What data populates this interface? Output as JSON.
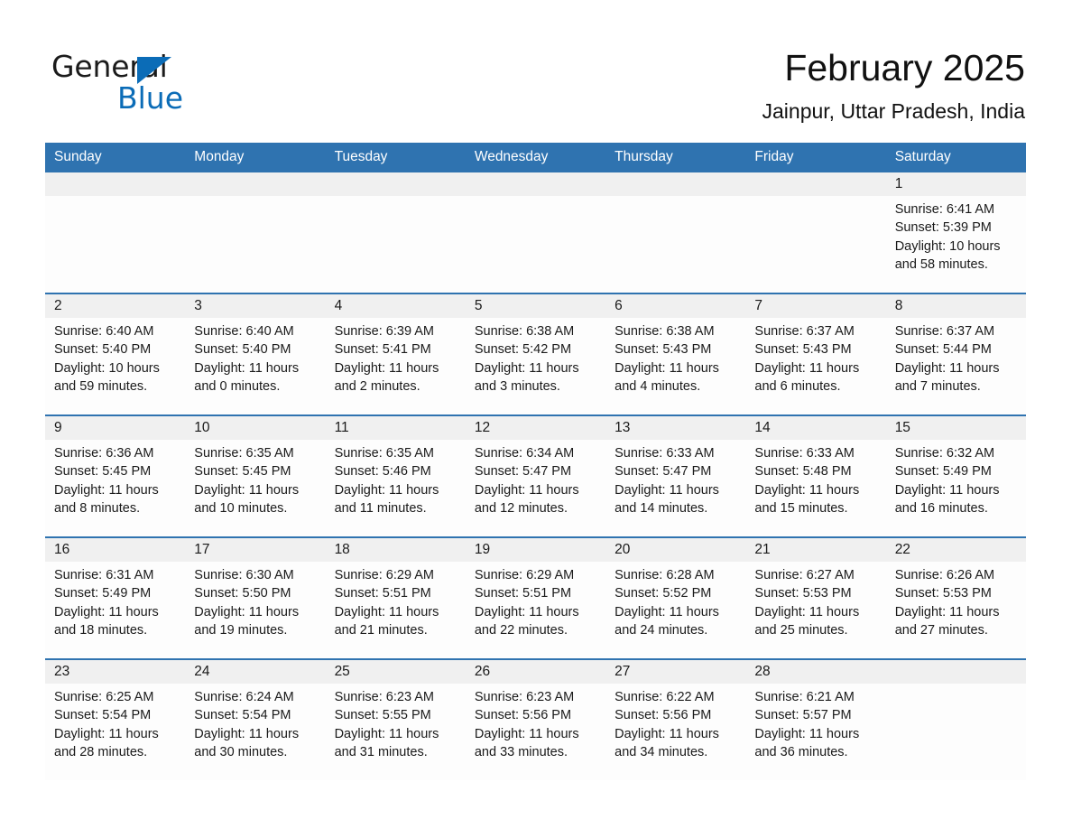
{
  "logo": {
    "word_one": "General",
    "word_two": "Blue",
    "accent_color": "#0b6cb7"
  },
  "header": {
    "title": "February 2025",
    "subtitle": "Jainpur, Uttar Pradesh, India"
  },
  "theme": {
    "header_blue": "#2f73b0",
    "band_gray": "#f0f0f0",
    "cell_white": "#fdfdfd",
    "text": "#1a1a1a"
  },
  "weekdays": [
    "Sunday",
    "Monday",
    "Tuesday",
    "Wednesday",
    "Thursday",
    "Friday",
    "Saturday"
  ],
  "weeks": [
    [
      {
        "day": "",
        "sunrise": "",
        "sunset": "",
        "daylight": ""
      },
      {
        "day": "",
        "sunrise": "",
        "sunset": "",
        "daylight": ""
      },
      {
        "day": "",
        "sunrise": "",
        "sunset": "",
        "daylight": ""
      },
      {
        "day": "",
        "sunrise": "",
        "sunset": "",
        "daylight": ""
      },
      {
        "day": "",
        "sunrise": "",
        "sunset": "",
        "daylight": ""
      },
      {
        "day": "",
        "sunrise": "",
        "sunset": "",
        "daylight": ""
      },
      {
        "day": "1",
        "sunrise": "Sunrise: 6:41 AM",
        "sunset": "Sunset: 5:39 PM",
        "daylight": "Daylight: 10 hours and 58 minutes."
      }
    ],
    [
      {
        "day": "2",
        "sunrise": "Sunrise: 6:40 AM",
        "sunset": "Sunset: 5:40 PM",
        "daylight": "Daylight: 10 hours and 59 minutes."
      },
      {
        "day": "3",
        "sunrise": "Sunrise: 6:40 AM",
        "sunset": "Sunset: 5:40 PM",
        "daylight": "Daylight: 11 hours and 0 minutes."
      },
      {
        "day": "4",
        "sunrise": "Sunrise: 6:39 AM",
        "sunset": "Sunset: 5:41 PM",
        "daylight": "Daylight: 11 hours and 2 minutes."
      },
      {
        "day": "5",
        "sunrise": "Sunrise: 6:38 AM",
        "sunset": "Sunset: 5:42 PM",
        "daylight": "Daylight: 11 hours and 3 minutes."
      },
      {
        "day": "6",
        "sunrise": "Sunrise: 6:38 AM",
        "sunset": "Sunset: 5:43 PM",
        "daylight": "Daylight: 11 hours and 4 minutes."
      },
      {
        "day": "7",
        "sunrise": "Sunrise: 6:37 AM",
        "sunset": "Sunset: 5:43 PM",
        "daylight": "Daylight: 11 hours and 6 minutes."
      },
      {
        "day": "8",
        "sunrise": "Sunrise: 6:37 AM",
        "sunset": "Sunset: 5:44 PM",
        "daylight": "Daylight: 11 hours and 7 minutes."
      }
    ],
    [
      {
        "day": "9",
        "sunrise": "Sunrise: 6:36 AM",
        "sunset": "Sunset: 5:45 PM",
        "daylight": "Daylight: 11 hours and 8 minutes."
      },
      {
        "day": "10",
        "sunrise": "Sunrise: 6:35 AM",
        "sunset": "Sunset: 5:45 PM",
        "daylight": "Daylight: 11 hours and 10 minutes."
      },
      {
        "day": "11",
        "sunrise": "Sunrise: 6:35 AM",
        "sunset": "Sunset: 5:46 PM",
        "daylight": "Daylight: 11 hours and 11 minutes."
      },
      {
        "day": "12",
        "sunrise": "Sunrise: 6:34 AM",
        "sunset": "Sunset: 5:47 PM",
        "daylight": "Daylight: 11 hours and 12 minutes."
      },
      {
        "day": "13",
        "sunrise": "Sunrise: 6:33 AM",
        "sunset": "Sunset: 5:47 PM",
        "daylight": "Daylight: 11 hours and 14 minutes."
      },
      {
        "day": "14",
        "sunrise": "Sunrise: 6:33 AM",
        "sunset": "Sunset: 5:48 PM",
        "daylight": "Daylight: 11 hours and 15 minutes."
      },
      {
        "day": "15",
        "sunrise": "Sunrise: 6:32 AM",
        "sunset": "Sunset: 5:49 PM",
        "daylight": "Daylight: 11 hours and 16 minutes."
      }
    ],
    [
      {
        "day": "16",
        "sunrise": "Sunrise: 6:31 AM",
        "sunset": "Sunset: 5:49 PM",
        "daylight": "Daylight: 11 hours and 18 minutes."
      },
      {
        "day": "17",
        "sunrise": "Sunrise: 6:30 AM",
        "sunset": "Sunset: 5:50 PM",
        "daylight": "Daylight: 11 hours and 19 minutes."
      },
      {
        "day": "18",
        "sunrise": "Sunrise: 6:29 AM",
        "sunset": "Sunset: 5:51 PM",
        "daylight": "Daylight: 11 hours and 21 minutes."
      },
      {
        "day": "19",
        "sunrise": "Sunrise: 6:29 AM",
        "sunset": "Sunset: 5:51 PM",
        "daylight": "Daylight: 11 hours and 22 minutes."
      },
      {
        "day": "20",
        "sunrise": "Sunrise: 6:28 AM",
        "sunset": "Sunset: 5:52 PM",
        "daylight": "Daylight: 11 hours and 24 minutes."
      },
      {
        "day": "21",
        "sunrise": "Sunrise: 6:27 AM",
        "sunset": "Sunset: 5:53 PM",
        "daylight": "Daylight: 11 hours and 25 minutes."
      },
      {
        "day": "22",
        "sunrise": "Sunrise: 6:26 AM",
        "sunset": "Sunset: 5:53 PM",
        "daylight": "Daylight: 11 hours and 27 minutes."
      }
    ],
    [
      {
        "day": "23",
        "sunrise": "Sunrise: 6:25 AM",
        "sunset": "Sunset: 5:54 PM",
        "daylight": "Daylight: 11 hours and 28 minutes."
      },
      {
        "day": "24",
        "sunrise": "Sunrise: 6:24 AM",
        "sunset": "Sunset: 5:54 PM",
        "daylight": "Daylight: 11 hours and 30 minutes."
      },
      {
        "day": "25",
        "sunrise": "Sunrise: 6:23 AM",
        "sunset": "Sunset: 5:55 PM",
        "daylight": "Daylight: 11 hours and 31 minutes."
      },
      {
        "day": "26",
        "sunrise": "Sunrise: 6:23 AM",
        "sunset": "Sunset: 5:56 PM",
        "daylight": "Daylight: 11 hours and 33 minutes."
      },
      {
        "day": "27",
        "sunrise": "Sunrise: 6:22 AM",
        "sunset": "Sunset: 5:56 PM",
        "daylight": "Daylight: 11 hours and 34 minutes."
      },
      {
        "day": "28",
        "sunrise": "Sunrise: 6:21 AM",
        "sunset": "Sunset: 5:57 PM",
        "daylight": "Daylight: 11 hours and 36 minutes."
      },
      {
        "day": "",
        "sunrise": "",
        "sunset": "",
        "daylight": ""
      }
    ]
  ]
}
